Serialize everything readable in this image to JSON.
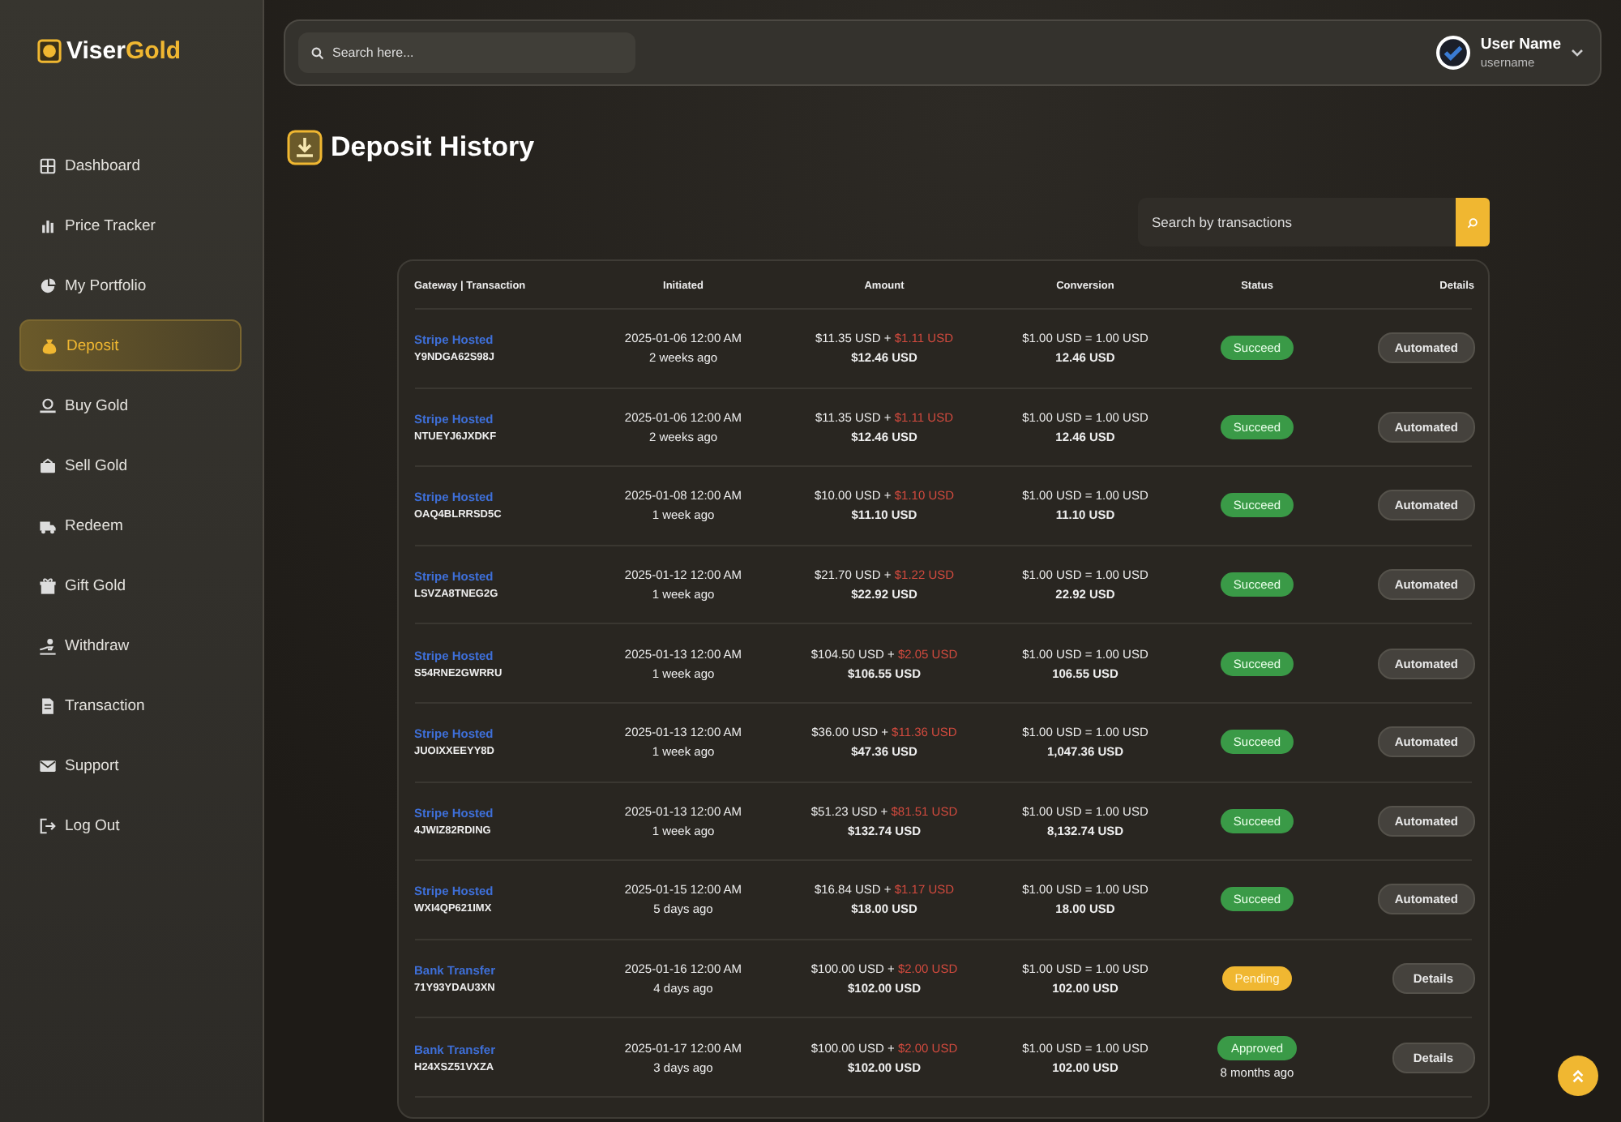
{
  "logo": {
    "parts": [
      "Viser",
      "Gold"
    ]
  },
  "sidebar": {
    "items": [
      {
        "label": "Dashboard",
        "selected": false
      },
      {
        "label": "Price Tracker",
        "selected": false
      },
      {
        "label": "My Portfolio",
        "selected": false
      },
      {
        "label": "Deposit",
        "selected": true
      },
      {
        "label": "Buy Gold",
        "selected": false
      },
      {
        "label": "Sell Gold",
        "selected": false
      },
      {
        "label": "Redeem",
        "selected": false
      },
      {
        "label": "Gift Gold",
        "selected": false
      },
      {
        "label": "Withdraw",
        "selected": false
      },
      {
        "label": "Transaction",
        "selected": false
      },
      {
        "label": "Support",
        "selected": false
      },
      {
        "label": "Log Out",
        "selected": false
      }
    ]
  },
  "topbar": {
    "search": {
      "placeholder": "Search here..."
    },
    "user": {
      "name": "User Name",
      "username": "username"
    }
  },
  "page": {
    "title": "Deposit History",
    "search": {
      "placeholder": "Search by transactions"
    }
  },
  "table": {
    "columns": [
      "Gateway | Transaction",
      "Initiated",
      "Amount",
      "Conversion",
      "Status",
      "Details"
    ],
    "rows": [
      {
        "gateway": "Stripe Hosted",
        "transaction": "Y9NDGA62S98J",
        "date": "2025-01-06 12:00 AM",
        "ago": "2 weeks ago",
        "amount": "$11.35 USD +",
        "charge": "$1.11 USD",
        "total": "$12.46 USD",
        "rate": "$1.00 USD = 1.00 USD",
        "converted": "12.46 USD",
        "status": {
          "label": "Succeed",
          "kind": "success"
        },
        "action": {
          "label": "Automated",
          "kind": "automated"
        }
      },
      {
        "gateway": "Stripe Hosted",
        "transaction": "NTUEYJ6JXDKF",
        "date": "2025-01-06 12:00 AM",
        "ago": "2 weeks ago",
        "amount": "$11.35 USD +",
        "charge": "$1.11 USD",
        "total": "$12.46 USD",
        "rate": "$1.00 USD = 1.00 USD",
        "converted": "12.46 USD",
        "status": {
          "label": "Succeed",
          "kind": "success"
        },
        "action": {
          "label": "Automated",
          "kind": "automated"
        }
      },
      {
        "gateway": "Stripe Hosted",
        "transaction": "OAQ4BLRRSD5C",
        "date": "2025-01-08 12:00 AM",
        "ago": "1 week ago",
        "amount": "$10.00 USD +",
        "charge": "$1.10 USD",
        "total": "$11.10 USD",
        "rate": "$1.00 USD = 1.00 USD",
        "converted": "11.10 USD",
        "status": {
          "label": "Succeed",
          "kind": "success"
        },
        "action": {
          "label": "Automated",
          "kind": "automated"
        }
      },
      {
        "gateway": "Stripe Hosted",
        "transaction": "LSVZA8TNEG2G",
        "date": "2025-01-12 12:00 AM",
        "ago": "1 week ago",
        "amount": "$21.70 USD +",
        "charge": "$1.22 USD",
        "total": "$22.92 USD",
        "rate": "$1.00 USD = 1.00 USD",
        "converted": "22.92 USD",
        "status": {
          "label": "Succeed",
          "kind": "success"
        },
        "action": {
          "label": "Automated",
          "kind": "automated"
        }
      },
      {
        "gateway": "Stripe Hosted",
        "transaction": "S54RNE2GWRRU",
        "date": "2025-01-13 12:00 AM",
        "ago": "1 week ago",
        "amount": "$104.50 USD +",
        "charge": "$2.05 USD",
        "total": "$106.55 USD",
        "rate": "$1.00 USD = 1.00 USD",
        "converted": "106.55 USD",
        "status": {
          "label": "Succeed",
          "kind": "success"
        },
        "action": {
          "label": "Automated",
          "kind": "automated"
        }
      },
      {
        "gateway": "Stripe Hosted",
        "transaction": "JUOIXXEEYY8D",
        "date": "2025-01-13 12:00 AM",
        "ago": "1 week ago",
        "amount": "$36.00 USD +",
        "charge": "$11.36 USD",
        "total": "$47.36 USD",
        "rate": "$1.00 USD = 1.00 USD",
        "converted": "1,047.36 USD",
        "status": {
          "label": "Succeed",
          "kind": "success"
        },
        "action": {
          "label": "Automated",
          "kind": "automated"
        }
      },
      {
        "gateway": "Stripe Hosted",
        "transaction": "4JWIZ82RDING",
        "date": "2025-01-13 12:00 AM",
        "ago": "1 week ago",
        "amount": "$51.23 USD +",
        "charge": "$81.51 USD",
        "total": "$132.74 USD",
        "rate": "$1.00 USD = 1.00 USD",
        "converted": "8,132.74 USD",
        "status": {
          "label": "Succeed",
          "kind": "success"
        },
        "action": {
          "label": "Automated",
          "kind": "automated"
        }
      },
      {
        "gateway": "Stripe Hosted",
        "transaction": "WXI4QP621IMX",
        "date": "2025-01-15 12:00 AM",
        "ago": "5 days ago",
        "amount": "$16.84 USD +",
        "charge": "$1.17 USD",
        "total": "$18.00 USD",
        "rate": "$1.00 USD = 1.00 USD",
        "converted": "18.00 USD",
        "status": {
          "label": "Succeed",
          "kind": "success"
        },
        "action": {
          "label": "Automated",
          "kind": "automated"
        }
      },
      {
        "gateway": "Bank Transfer",
        "transaction": "71Y93YDAU3XN",
        "date": "2025-01-16 12:00 AM",
        "ago": "4 days ago",
        "amount": "$100.00 USD +",
        "charge": "$2.00 USD",
        "total": "$102.00 USD",
        "rate": "$1.00 USD = 1.00 USD",
        "converted": "102.00 USD",
        "status": {
          "label": "Pending",
          "kind": "pending"
        },
        "action": {
          "label": "Details",
          "kind": "details"
        }
      },
      {
        "gateway": "Bank Transfer",
        "transaction": "H24XSZ51VXZA",
        "date": "2025-01-17 12:00 AM",
        "ago": "3 days ago",
        "amount": "$100.00 USD +",
        "charge": "$2.00 USD",
        "total": "$102.00 USD",
        "rate": "$1.00 USD = 1.00 USD",
        "converted": "102.00 USD",
        "status": {
          "label": "Approved",
          "kind": "success",
          "note": "8 months ago"
        },
        "action": {
          "label": "Details",
          "kind": "details"
        }
      }
    ]
  }
}
